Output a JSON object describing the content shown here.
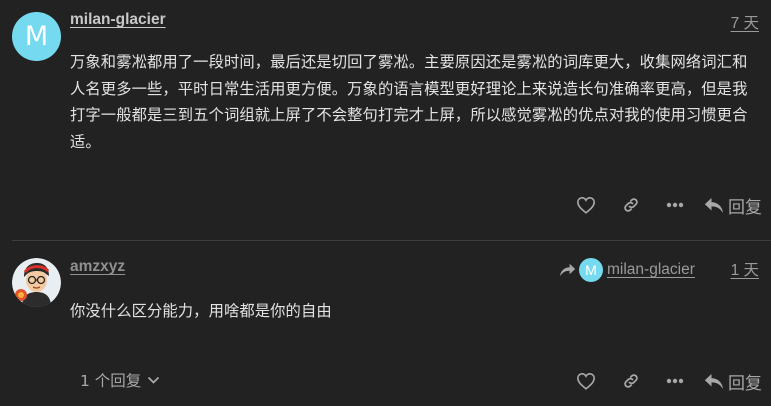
{
  "posts": [
    {
      "avatar_letter": "M",
      "username": "milan-glacier",
      "date": "7 天",
      "body": "万象和雾凇都用了一段时间，最后还是切回了雾凇。主要原因还是雾凇的词库更大，收集网络词汇和人名更多一些，平时日常生活用更方便。万象的语言模型更好理论上来说造长句准确率更高，但是我打字一般都是三到五个词组就上屏了不会整句打完才上屏，所以感觉雾凇的优点对我的使用习惯更合适。",
      "actions": {
        "like_icon": "heart-icon",
        "link_icon": "link-icon",
        "more_icon": "ellipsis-icon",
        "reply_label": "回复"
      }
    },
    {
      "avatar_icon": "cartoon-avatar",
      "username": "amzxyz",
      "date": "1 天",
      "reply_to": {
        "avatar_letter": "M",
        "username": "milan-glacier"
      },
      "body": "你没什么区分能力，用啥都是你的自由",
      "replies_toggle": "1 个回复",
      "actions": {
        "like_icon": "heart-icon",
        "link_icon": "link-icon",
        "more_icon": "ellipsis-icon",
        "reply_label": "回复"
      }
    }
  ],
  "colors": {
    "background": "#222222",
    "avatar_m": "#75daef",
    "text": "#e3e3e3",
    "muted": "#a8a8a8"
  }
}
